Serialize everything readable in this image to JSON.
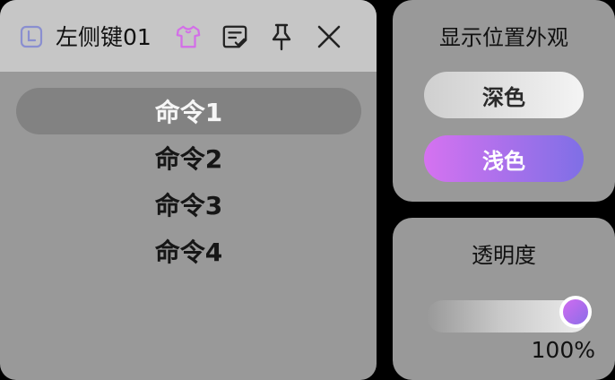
{
  "window": {
    "title": "左侧键01",
    "icons": [
      "clock-square-icon",
      "shirt-icon",
      "note-check-icon",
      "pin-icon",
      "close-icon"
    ],
    "colors": {
      "shirt_icon": "#d36ee8",
      "clock_icon": "#8a8fd0"
    }
  },
  "commands": [
    {
      "label": "命令1",
      "selected": true
    },
    {
      "label": "命令2",
      "selected": false
    },
    {
      "label": "命令3",
      "selected": false
    },
    {
      "label": "命令4",
      "selected": false
    }
  ],
  "appearance": {
    "title": "显示位置外观",
    "dark_label": "深色",
    "light_label": "浅色",
    "accent_gradient": [
      "#d572f0",
      "#7f6fe6"
    ]
  },
  "opacity": {
    "title": "透明度",
    "value": 1.0,
    "value_text": "100%"
  }
}
